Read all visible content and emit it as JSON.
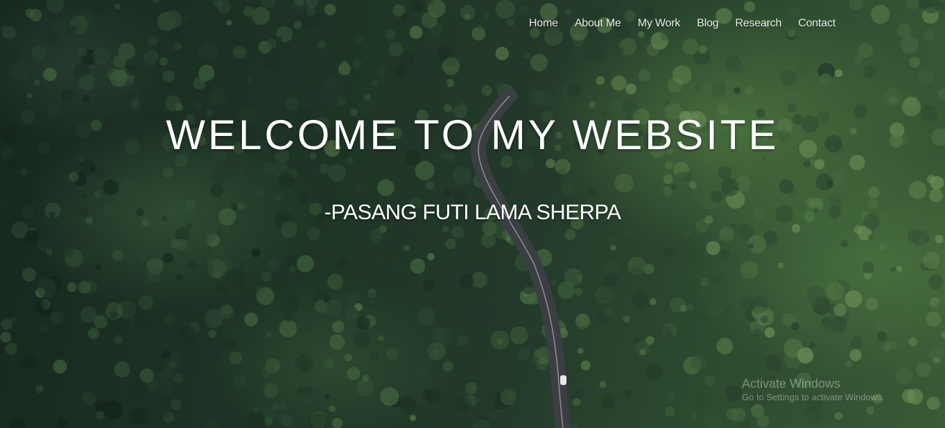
{
  "nav": {
    "items": [
      {
        "label": "Home"
      },
      {
        "label": "About Me"
      },
      {
        "label": "My Work"
      },
      {
        "label": "Blog"
      },
      {
        "label": "Research"
      },
      {
        "label": "Contact"
      }
    ]
  },
  "hero": {
    "title": "WELCOME TO MY WEBSITE",
    "subtitle": "-PASANG FUTI LAMA SHERPA",
    "background_image": "aerial-forest-road"
  },
  "watermark": {
    "title": "Activate Windows",
    "subtitle": "Go to Settings to activate Windows."
  },
  "colors": {
    "text": "#ffffff",
    "nav_text": "#e8ece6",
    "forest_dark": "#17281f",
    "forest_light": "#3a5a35"
  }
}
